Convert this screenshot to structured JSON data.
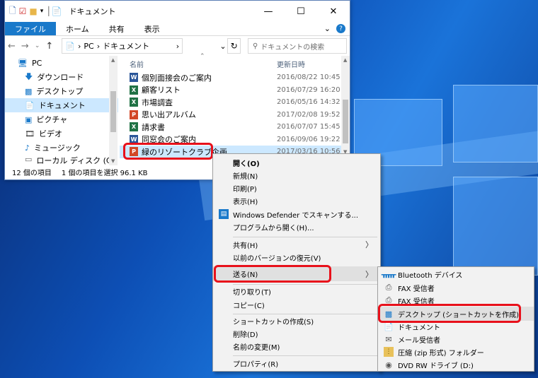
{
  "colors": {
    "accent": "#1979ca",
    "highlight_box": "#e8111b",
    "selection": "#cce8ff"
  },
  "window": {
    "title": "ドキュメント",
    "ribbon_tabs": [
      "ファイル",
      "ホーム",
      "共有",
      "表示"
    ],
    "help_icon": "?",
    "breadcrumb": [
      "PC",
      "ドキュメント"
    ],
    "search_placeholder": "ドキュメントの検索",
    "columns": {
      "name": "名前",
      "modified": "更新日時"
    }
  },
  "nav_items": [
    {
      "label": "PC",
      "icon": "pc-icon"
    },
    {
      "label": "ダウンロード",
      "icon": "download-icon"
    },
    {
      "label": "デスクトップ",
      "icon": "desktop-icon"
    },
    {
      "label": "ドキュメント",
      "icon": "document-icon",
      "selected": true
    },
    {
      "label": "ピクチャ",
      "icon": "picture-icon"
    },
    {
      "label": "ビデオ",
      "icon": "video-icon"
    },
    {
      "label": "ミュージック",
      "icon": "music-icon"
    },
    {
      "label": "ローカル ディスク (C:)",
      "icon": "disk-icon"
    }
  ],
  "files": [
    {
      "name": "個別面接会のご案内",
      "date": "2016/08/22 10:45",
      "type": "w"
    },
    {
      "name": "顧客リスト",
      "date": "2016/07/29 16:20",
      "type": "x"
    },
    {
      "name": "市場調査",
      "date": "2016/05/16 14:32",
      "type": "x"
    },
    {
      "name": "思い出アルバム",
      "date": "2017/02/08 19:52",
      "type": "p"
    },
    {
      "name": "請求書",
      "date": "2016/07/07 15:45",
      "type": "x"
    },
    {
      "name": "同窓会のご案内",
      "date": "2016/09/06 19:22",
      "type": "w"
    },
    {
      "name": "緑のリゾートクラブ企画",
      "date": "2017/03/16 10:56",
      "type": "p",
      "selected": true
    }
  ],
  "status": {
    "item_count": "12 個の項目",
    "selection": "1 個の項目を選択  96.1 KB"
  },
  "context_menu": [
    {
      "label": "開く(O)",
      "bold": true
    },
    {
      "label": "新規(N)"
    },
    {
      "label": "印刷(P)"
    },
    {
      "label": "表示(H)"
    },
    {
      "label": "Windows Defender でスキャンする...",
      "icon": "defender-icon"
    },
    {
      "label": "プログラムから開く(H)..."
    },
    {
      "label": "共有(H)",
      "submenu": true,
      "sep_before": true
    },
    {
      "label": "以前のバージョンの復元(V)"
    },
    {
      "label": "送る(N)",
      "submenu": true,
      "sep_before": true,
      "highlighted": true
    },
    {
      "label": "切り取り(T)",
      "sep_before": true
    },
    {
      "label": "コピー(C)"
    },
    {
      "label": "ショートカットの作成(S)",
      "sep_before": true
    },
    {
      "label": "削除(D)"
    },
    {
      "label": "名前の変更(M)"
    },
    {
      "label": "プロパティ(R)",
      "sep_before": true
    }
  ],
  "sendto_menu": [
    {
      "label": "Bluetooth デバイス",
      "icon": "bluetooth-icon"
    },
    {
      "label": "FAX 受信者",
      "icon": "fax-icon"
    },
    {
      "label": "FAX 受信者",
      "icon": "fax-icon"
    },
    {
      "label": "デスクトップ (ショートカットを作成)",
      "icon": "desktop-icon",
      "highlighted": true
    },
    {
      "label": "ドキュメント",
      "icon": "document-icon"
    },
    {
      "label": "メール受信者",
      "icon": "mail-icon"
    },
    {
      "label": "圧縮 (zip 形式) フォルダー",
      "icon": "zip-icon"
    },
    {
      "label": "DVD RW ドライブ (D:)",
      "icon": "dvd-icon"
    }
  ]
}
